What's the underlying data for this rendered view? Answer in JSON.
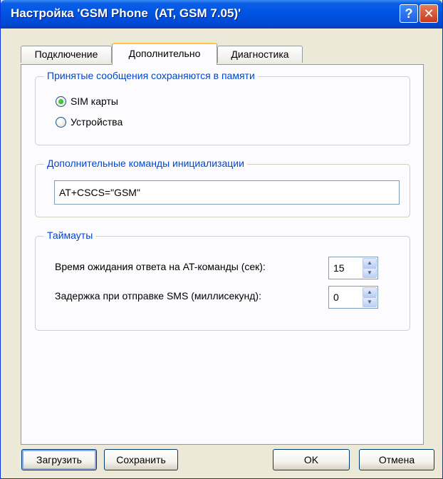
{
  "window": {
    "title": "Настройка 'GSM Phone  (AT, GSM 7.05)'",
    "help_glyph": "?",
    "close_glyph": "✕"
  },
  "tabs": [
    {
      "label": "Подключение",
      "active": false
    },
    {
      "label": "Дополнительно",
      "active": true
    },
    {
      "label": "Диагностика",
      "active": false
    }
  ],
  "storage_group": {
    "legend": "Принятые сообщения сохраняются в памяти",
    "options": [
      {
        "label": "SIM карты",
        "checked": true
      },
      {
        "label": "Устройства",
        "checked": false
      }
    ]
  },
  "init_group": {
    "legend": "Дополнительные команды инициализации",
    "value": "AT+CSCS=\"GSM\""
  },
  "timeouts_group": {
    "legend": "Таймауты",
    "rows": [
      {
        "label": "Время ожидания ответа на AT-команды (сек):",
        "value": "15"
      },
      {
        "label": "Задержка при отправке SMS (миллисекунд):",
        "value": "0"
      }
    ],
    "up_glyph": "▲",
    "down_glyph": "▼"
  },
  "buttons": {
    "load": "Загрузить",
    "save": "Сохранить",
    "ok": "OK",
    "cancel": "Отмена"
  },
  "colors": {
    "titlebar": "#0054e3",
    "legend_text": "#0046d5",
    "dialog_bg": "#ece9d8",
    "tab_active_top": "#ffc83c"
  }
}
